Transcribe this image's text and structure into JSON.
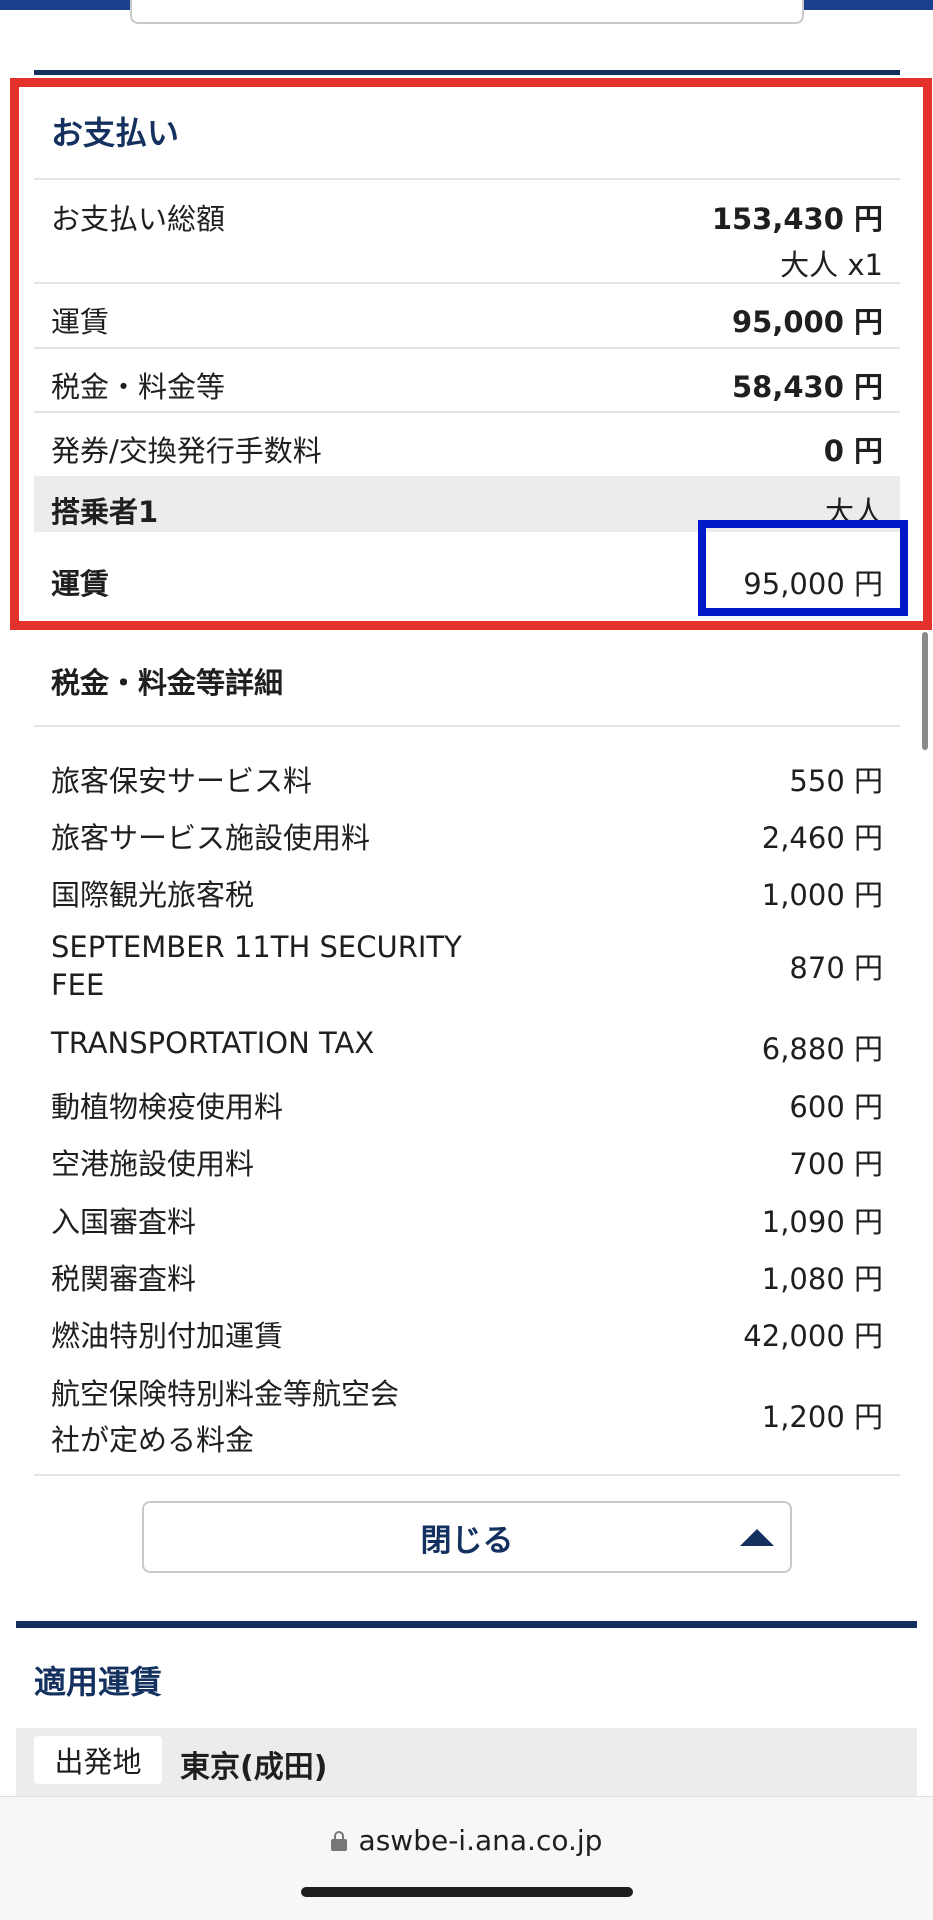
{
  "payment": {
    "title": "お支払い",
    "rows": [
      {
        "label": "お支払い総額",
        "value": "153,430 円",
        "sub": "大人 x1"
      },
      {
        "label": "運賃",
        "value": "95,000 円"
      },
      {
        "label": "税金・料金等",
        "value": "58,430 円"
      },
      {
        "label": "発券/交換発行手数料",
        "value": "0 円"
      }
    ],
    "passenger": {
      "label": "搭乗者1",
      "type": "大人"
    },
    "fare": {
      "label": "運賃",
      "value": "95,000 円"
    }
  },
  "tax_details": {
    "title": "税金・料金等詳細",
    "items": [
      {
        "label": "旅客保安サービス料",
        "value": "550 円"
      },
      {
        "label": "旅客サービス施設使用料",
        "value": "2,460 円"
      },
      {
        "label": "国際観光旅客税",
        "value": "1,000 円"
      },
      {
        "label": "SEPTEMBER 11TH SECURITY",
        "label2": "FEE",
        "value": "870 円"
      },
      {
        "label": "TRANSPORTATION TAX",
        "value": "6,880 円"
      },
      {
        "label": "動植物検疫使用料",
        "value": "600 円"
      },
      {
        "label": "空港施設使用料",
        "value": "700 円"
      },
      {
        "label": "入国審査料",
        "value": "1,090 円"
      },
      {
        "label": "税関審査料",
        "value": "1,080 円"
      },
      {
        "label": "燃油特別付加運賃",
        "value": "42,000 円"
      },
      {
        "label": "航空保険特別料金等航空会",
        "label2": "社が定める料金",
        "value": "1,200 円"
      }
    ]
  },
  "close_button": {
    "label": "閉じる"
  },
  "applied_fare": {
    "title": "適用運賃",
    "origin_label": "出発地",
    "origin_value": "東京(成田)"
  },
  "browser": {
    "url": "aswbe-i.ana.co.jp"
  },
  "colors": {
    "brand_navy": "#13305e",
    "highlight_red": "#e3322b",
    "highlight_blue": "#0018c8"
  },
  "icons": {
    "lock": "lock-icon",
    "collapse": "triangle-up-icon"
  }
}
